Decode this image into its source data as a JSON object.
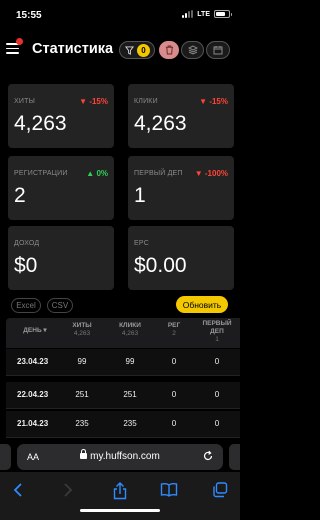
{
  "status_bar": {
    "time": "15:55",
    "network": "LTE"
  },
  "header": {
    "title": "Статистика",
    "filter_count": "0"
  },
  "cards": [
    {
      "label": "ХИТЫ",
      "value": "4,263",
      "change": "-15%",
      "trend": "down"
    },
    {
      "label": "КЛИКИ",
      "value": "4,263",
      "change": "-15%",
      "trend": "down"
    },
    {
      "label": "РЕГИСТРАЦИИ",
      "value": "2",
      "change": "0%",
      "trend": "up"
    },
    {
      "label": "ПЕРВЫЙ ДЕП",
      "value": "1",
      "change": "-100%",
      "trend": "down"
    },
    {
      "label": "ДОХОД",
      "value": "$0",
      "change": "",
      "trend": ""
    },
    {
      "label": "EPC",
      "value": "$0.00",
      "change": "",
      "trend": ""
    }
  ],
  "export": {
    "excel": "Excel",
    "csv": "CSV"
  },
  "update_label": "Обновить",
  "table": {
    "columns": [
      {
        "label": "ДЕНЬ",
        "sub": ""
      },
      {
        "label": "ХИТЫ",
        "sub": "4,263"
      },
      {
        "label": "КЛИКИ",
        "sub": "4,263"
      },
      {
        "label": "РЕГ",
        "sub": "2"
      },
      {
        "label": "ПЕРВЫЙ ДЕП",
        "sub": "1"
      }
    ],
    "rows": [
      [
        "23.04.23",
        "99",
        "99",
        "0",
        "0"
      ],
      [
        "22.04.23",
        "251",
        "251",
        "0",
        "0"
      ],
      [
        "21.04.23",
        "235",
        "235",
        "0",
        "0"
      ]
    ]
  },
  "browser": {
    "aa": "AA",
    "url": "my.huffson.com"
  },
  "colors": {
    "accent": "#f3c800",
    "negative": "#ff453a",
    "positive": "#30d158",
    "card": "#232323"
  }
}
